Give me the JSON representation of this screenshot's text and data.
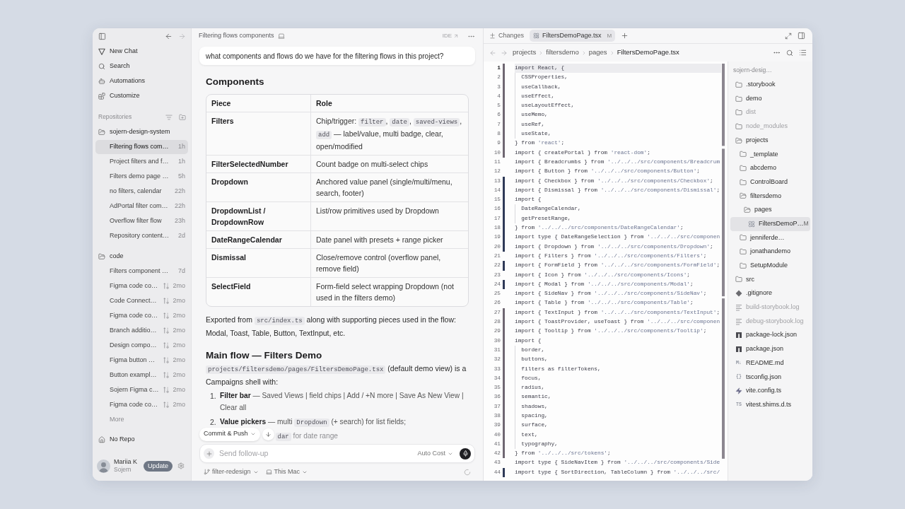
{
  "sidebar": {
    "history": [
      {
        "kind": "back",
        "disabled": false
      },
      {
        "kind": "forward",
        "disabled": true
      }
    ],
    "nav": [
      {
        "kind": "new-chat",
        "label": "New Chat"
      },
      {
        "kind": "search",
        "label": "Search"
      },
      {
        "kind": "automations",
        "label": "Automations"
      },
      {
        "kind": "customize",
        "label": "Customize"
      }
    ],
    "section_title": "Repositories",
    "repos": [
      {
        "name": "sojern-design-system",
        "chats": [
          {
            "title": "Filtering flows com…",
            "age": "1h",
            "kind": "local",
            "selected": true
          },
          {
            "title": "Project filters and f…",
            "age": "1h",
            "kind": "local",
            "selected": false
          },
          {
            "title": "Filters demo page …",
            "age": "5h",
            "kind": "local",
            "selected": false
          },
          {
            "title": "no filters, calendar",
            "age": "22h",
            "kind": "local",
            "selected": false
          },
          {
            "title": "AdPortal filter com…",
            "age": "22h",
            "kind": "local",
            "selected": false
          },
          {
            "title": "Overflow filter flow",
            "age": "23h",
            "kind": "local",
            "selected": false
          },
          {
            "title": "Repository content…",
            "age": "2d",
            "kind": "local",
            "selected": false
          }
        ]
      },
      {
        "name": "code",
        "chats": [
          {
            "title": "Filters component …",
            "age": "7d",
            "kind": "local",
            "selected": false
          },
          {
            "title": "Figma code co…",
            "age": "2mo",
            "kind": "remote",
            "selected": false
          },
          {
            "title": "Code Connect…",
            "age": "2mo",
            "kind": "remote",
            "selected": false
          },
          {
            "title": "Figma code co…",
            "age": "2mo",
            "kind": "remote",
            "selected": false
          },
          {
            "title": "Branch additio…",
            "age": "2mo",
            "kind": "remote",
            "selected": false
          },
          {
            "title": "Design compo…",
            "age": "2mo",
            "kind": "remote",
            "selected": false
          },
          {
            "title": "Figma button …",
            "age": "2mo",
            "kind": "remote",
            "selected": false
          },
          {
            "title": "Button exampl…",
            "age": "2mo",
            "kind": "remote",
            "selected": false
          },
          {
            "title": "Sojern Figma c…",
            "age": "2mo",
            "kind": "remote",
            "selected": false
          },
          {
            "title": "Figma code co…",
            "age": "2mo",
            "kind": "remote",
            "selected": false
          }
        ]
      }
    ],
    "more": "More",
    "no_repo": "No Repo",
    "user": {
      "name": "Mariia K",
      "org": "Sojern",
      "update_label": "Update"
    }
  },
  "chat": {
    "title": "Filtering flows components",
    "ide_label": "IDE",
    "user_message": "what components and flows do we have for the filtering flows in this project?",
    "blocks": [
      {
        "kind": "heading",
        "text": "Components"
      },
      {
        "kind": "table",
        "columns": [
          "Piece",
          "Role"
        ],
        "rows": [
          {
            "piece": "Filters",
            "role": [
              {
                "kind": "text",
                "text": "Chip/trigger: "
              },
              {
                "kind": "code",
                "text": "filter"
              },
              {
                "kind": "text",
                "text": ", "
              },
              {
                "kind": "code",
                "text": "date"
              },
              {
                "kind": "text",
                "text": ", "
              },
              {
                "kind": "code",
                "text": "saved-views"
              },
              {
                "kind": "text",
                "text": ", "
              },
              {
                "kind": "code",
                "text": "add"
              },
              {
                "kind": "text",
                "text": " — label/value, multi badge, clear, open/modified"
              }
            ]
          },
          {
            "piece": "FilterSelectedNumber",
            "role": [
              {
                "kind": "text",
                "text": "Count badge on multi-select chips"
              }
            ]
          },
          {
            "piece": "Dropdown",
            "role": [
              {
                "kind": "text",
                "text": "Anchored value panel (single/multi/menu, search, footer)"
              }
            ]
          },
          {
            "piece": "DropdownList / DropdownRow",
            "role": [
              {
                "kind": "text",
                "text": "List/row primitives used by Dropdown"
              }
            ]
          },
          {
            "piece": "DateRangeCalendar",
            "role": [
              {
                "kind": "text",
                "text": "Date panel with presets + range picker"
              }
            ]
          },
          {
            "piece": "Dismissal",
            "role": [
              {
                "kind": "text",
                "text": "Close/remove control (overflow panel, remove field)"
              }
            ]
          },
          {
            "piece": "SelectField",
            "role": [
              {
                "kind": "text",
                "text": "Form-field select wrapping Dropdown (not used in the filters demo)"
              }
            ]
          }
        ]
      },
      {
        "kind": "paragraph",
        "segments": [
          {
            "kind": "text",
            "text": "Exported from "
          },
          {
            "kind": "code",
            "text": "src/index.ts"
          },
          {
            "kind": "text",
            "text": " along with supporting pieces used in the flow: Modal, Toast, Table, Button, TextInput, etc."
          }
        ]
      },
      {
        "kind": "heading",
        "text": "Main flow — Filters Demo"
      },
      {
        "kind": "paragraph",
        "segments": [
          {
            "kind": "code",
            "text": "projects/filtersdemo/pages/FiltersDemoPage.tsx"
          },
          {
            "kind": "text",
            "text": " (default demo view) is a Campaigns shell with:"
          }
        ]
      },
      {
        "kind": "list",
        "items": [
          {
            "marker": "1.",
            "segments": [
              {
                "kind": "text",
                "text": "**Filter bar** — Saved Views | field chips | Add / +N more | Save As New View | Clear all"
              }
            ]
          },
          {
            "marker": "2.",
            "segments": [
              {
                "kind": "text",
                "text": "**Value pickers** — multi "
              },
              {
                "kind": "code",
                "text": "Dropdown"
              },
              {
                "kind": "text",
                "text": " (+ search) for list fields;"
              }
            ]
          }
        ]
      }
    ],
    "floating": {
      "commit_label": "Commit & Push",
      "visible_text": [
        {
          "kind": "code",
          "text": "dar"
        },
        {
          "kind": "text",
          "text": " for date range"
        }
      ]
    },
    "composer": {
      "placeholder": "Send follow-up",
      "model": "Auto Cost"
    },
    "footer": {
      "branch": "filter-redesign",
      "machine": "This Mac"
    }
  },
  "editor": {
    "changes_label": "Changes",
    "tabs": [
      {
        "label": "FiltersDemoPage.tsx",
        "badge": "M",
        "selected": true
      }
    ],
    "breadcrumbs": [
      {
        "label": "projects",
        "current": false
      },
      {
        "label": "filtersdemo",
        "current": false
      },
      {
        "label": "pages",
        "current": false
      },
      {
        "label": "FiltersDemoPage.tsx",
        "current": true
      }
    ],
    "lines": [
      {
        "n": "1",
        "text": "import React, {",
        "color": "#6f6772",
        "current": true,
        "children": [
          {
            "n": "2",
            "text": "CSSProperties,",
            "color": "#6f6772",
            "current": false
          },
          {
            "n": "3",
            "text": "useCallback,",
            "color": "#6f6772",
            "current": false
          },
          {
            "n": "4",
            "text": "useEffect,",
            "color": "#6f6772",
            "current": false
          },
          {
            "n": "5",
            "text": "useLayoutEffect,",
            "color": "#6f6772",
            "current": false
          },
          {
            "n": "6",
            "text": "useMemo,",
            "color": "#6f6772",
            "current": false
          },
          {
            "n": "7",
            "text": "useRef,",
            "color": "#6f6772",
            "current": false
          },
          {
            "n": "8",
            "text": "useState,",
            "color": "#6f6772",
            "current": false
          }
        ]
      },
      {
        "n": "9",
        "text": "} from ",
        "string": "'react'",
        "end": ";",
        "color": "#6f6772",
        "current": false
      },
      {
        "n": "10",
        "text": "import { createPortal } from ",
        "string": "'react-dom'",
        "end": ";",
        "color": "#6f6772",
        "current": false
      },
      {
        "n": "11",
        "text": "import { Breadcrumbs } from ",
        "string": "'../../../src/components/Breadcrum",
        "current": false
      },
      {
        "n": "12",
        "text": "import { Button } from ",
        "string": "'../../../src/components/Button'",
        "end": ";",
        "current": false
      },
      {
        "n": "13",
        "text": "import { Checkbox } from ",
        "string": "'../../../src/components/Checkbox'",
        "end": ";",
        "color": "#2f3a58",
        "current": false
      },
      {
        "n": "14",
        "text": "import { Dismissal } from ",
        "string": "'../../../src/components/Dismissal'",
        "end": ";",
        "color": "#2f3a58",
        "current": false
      },
      {
        "n": "15",
        "text": "import {",
        "color": "#2f3a58",
        "current": false,
        "children": [
          {
            "n": "16",
            "text": "DateRangeCalendar,",
            "color": "#2f3a58",
            "current": false
          },
          {
            "n": "17",
            "text": "getPresetRange,",
            "color": "#2f3a58",
            "current": false
          }
        ]
      },
      {
        "n": "18",
        "text": "} from ",
        "string": "'../../../src/components/DateRangeCalendar'",
        "end": ";",
        "color": "#2f3a58",
        "current": false
      },
      {
        "n": "19",
        "text": "import type { DateRangeSelection } from ",
        "string": "'../../../src/componen",
        "color": "#2f3a58",
        "current": false
      },
      {
        "n": "20",
        "text": "import { Dropdown } from ",
        "string": "'../../../src/components/Dropdown'",
        "end": ";",
        "color": "#2f3a58",
        "current": false
      },
      {
        "n": "21",
        "text": "import { Filters } from ",
        "string": "'../../../src/components/Filters'",
        "end": ";",
        "current": false
      },
      {
        "n": "22",
        "text": "import { FormField } from ",
        "string": "'../../../src/components/FormField'",
        "end": ";",
        "color": "#2f3a58",
        "current": false
      },
      {
        "n": "23",
        "text": "import { Icon } from ",
        "string": "'../../../src/components/Icons'",
        "end": ";",
        "current": false
      },
      {
        "n": "24",
        "text": "import { Modal } from ",
        "string": "'../../../src/components/Modal'",
        "end": ";",
        "color": "#2f3a58",
        "current": false
      },
      {
        "n": "25",
        "text": "import { SideNav } from ",
        "string": "'../../../src/components/SideNav'",
        "end": ";",
        "current": false
      },
      {
        "n": "26",
        "text": "import { Table } from ",
        "string": "'../../../src/components/Table'",
        "end": ";",
        "current": false
      },
      {
        "n": "27",
        "text": "import { TextInput } from ",
        "string": "'../../../src/components/TextInput'",
        "end": ";",
        "color": "#6f6772",
        "current": false
      },
      {
        "n": "28",
        "text": "import { ToastProvider, useToast } from ",
        "string": "'../../../src/componen",
        "color": "#6f6772",
        "current": false
      },
      {
        "n": "29",
        "text": "import { Tooltip } from ",
        "string": "'../../../src/components/Tooltip'",
        "end": ";",
        "color": "#6f6772",
        "current": false
      },
      {
        "n": "30",
        "text": "import {",
        "color": "#6f6772",
        "current": false,
        "children": [
          {
            "n": "31",
            "text": "border,",
            "color": "#6f6772",
            "current": false
          },
          {
            "n": "32",
            "text": "buttons,",
            "color": "#6f6772",
            "current": false
          },
          {
            "n": "33",
            "text": "filters as filterTokens,",
            "color": "#6f6772",
            "current": false
          },
          {
            "n": "34",
            "text": "focus,",
            "color": "#6f6772",
            "current": false
          },
          {
            "n": "35",
            "text": "radius,",
            "color": "#6f6772",
            "current": false
          },
          {
            "n": "36",
            "text": "semantic,",
            "color": "#6f6772",
            "current": false
          },
          {
            "n": "37",
            "text": "shadows,",
            "color": "#6f6772",
            "current": false
          },
          {
            "n": "38",
            "text": "spacing,",
            "color": "#6f6772",
            "current": false
          },
          {
            "n": "39",
            "text": "surface,",
            "color": "#6f6772",
            "current": false
          },
          {
            "n": "40",
            "text": "text,",
            "color": "#6f6772",
            "current": false
          },
          {
            "n": "41",
            "text": "typography,",
            "color": "#6f6772",
            "current": false
          }
        ]
      },
      {
        "n": "42",
        "text": "} from ",
        "string": "'../../../src/tokens'",
        "end": ";",
        "color": "#6f6772",
        "current": false
      },
      {
        "n": "43",
        "text": "import type { SideNavItem } from ",
        "string": "'../../../src/components/Side",
        "current": false
      },
      {
        "n": "44",
        "text": "import type { SortDirection, TableColumn } from ",
        "string": "'../../../src/",
        "color": "#2f3a58",
        "current": false
      }
    ]
  },
  "file_tree": {
    "root": "sojern-desig…",
    "items": [
      {
        "label": ".storybook",
        "kind": "folder",
        "expanded": false,
        "ignored": false,
        "selected": false
      },
      {
        "label": "demo",
        "kind": "folder",
        "expanded": false,
        "ignored": false,
        "selected": false
      },
      {
        "label": "dist",
        "kind": "folder",
        "expanded": false,
        "ignored": true,
        "selected": false
      },
      {
        "label": "node_modules",
        "kind": "folder",
        "expanded": false,
        "ignored": true,
        "selected": false
      },
      {
        "label": "projects",
        "kind": "folder",
        "expanded": true,
        "ignored": false,
        "selected": false,
        "children": [
          {
            "label": "_template",
            "kind": "folder",
            "expanded": false,
            "ignored": false,
            "selected": false
          },
          {
            "label": "abcdemo",
            "kind": "folder",
            "expanded": false,
            "ignored": false,
            "selected": false
          },
          {
            "label": "ControlBoard",
            "kind": "folder",
            "expanded": false,
            "ignored": false,
            "selected": false
          },
          {
            "label": "filtersdemo",
            "kind": "folder",
            "expanded": true,
            "ignored": false,
            "selected": false,
            "children": [
              {
                "label": "pages",
                "kind": "folder",
                "expanded": true,
                "ignored": false,
                "selected": false,
                "children": [
                  {
                    "label": "FiltersDemoP…",
                    "kind": "react",
                    "badge": "M",
                    "ignored": false,
                    "selected": true
                  }
                ]
              }
            ]
          },
          {
            "label": "jenniferde…",
            "kind": "folder",
            "expanded": false,
            "ignored": false,
            "selected": false
          },
          {
            "label": "jonathandemo",
            "kind": "folder",
            "expanded": false,
            "ignored": false,
            "selected": false
          },
          {
            "label": "SetupModule",
            "kind": "folder",
            "expanded": false,
            "ignored": false,
            "selected": false
          }
        ]
      },
      {
        "label": "src",
        "kind": "folder",
        "expanded": false,
        "ignored": false,
        "selected": false
      },
      {
        "label": ".gitignore",
        "kind": "git",
        "ignored": false,
        "selected": false
      },
      {
        "label": "build-storybook.log",
        "kind": "log",
        "ignored": true,
        "selected": false
      },
      {
        "label": "debug-storybook.log",
        "kind": "log",
        "ignored": true,
        "selected": false
      },
      {
        "label": "package-lock.json",
        "kind": "npm",
        "ignored": false,
        "selected": false
      },
      {
        "label": "package.json",
        "kind": "npm",
        "ignored": false,
        "selected": false
      },
      {
        "label": "README.md",
        "kind": "glyph",
        "icon_text": "M↓",
        "ignored": false,
        "selected": false
      },
      {
        "label": "tsconfig.json",
        "kind": "glyph",
        "icon_text": "{}",
        "ignored": false,
        "selected": false
      },
      {
        "label": "vite.config.ts",
        "kind": "vite",
        "ignored": false,
        "selected": false
      },
      {
        "label": "vitest.shims.d.ts",
        "kind": "glyph",
        "icon_text": "TS",
        "ignored": false,
        "selected": false
      }
    ]
  }
}
